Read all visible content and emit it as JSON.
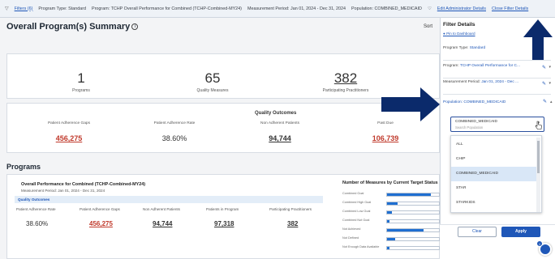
{
  "filterbar": {
    "filters": "Filters (6)",
    "program_type": "Program Type: Standard",
    "program": "Program: TCHP Overall Performance for Combined (TCHP-Combined-MY24)",
    "period": "Measurement Period: Jan 01, 2024 - Dec 31, 2024",
    "population": "Population: COMBINED_MEDICAID",
    "edit_link": "Edit Administrator Details",
    "close_link": "Close Filter Details"
  },
  "summary": {
    "title": "Overall Program(s) Summary",
    "sort_label": "Sort",
    "stats": [
      {
        "value": "1",
        "label": "Programs"
      },
      {
        "value": "65",
        "label": "Quality Measures"
      },
      {
        "value": "382",
        "label": "Participating Practitioners"
      }
    ]
  },
  "quality_outcomes": {
    "title": "Quality Outcomes",
    "cols": [
      {
        "label": "Patient Adherence Gaps",
        "value": "456,275"
      },
      {
        "label": "Patient Adherence Rate",
        "value": "38.60%"
      },
      {
        "label": "Non Adherent Patients",
        "value": "94,744"
      },
      {
        "label": "Past Due",
        "value": "106,739"
      }
    ]
  },
  "programs": {
    "title": "Programs",
    "card_title": "Overall Performance for Combined (TCHP-Combined-MY24)",
    "card_sub": "Measurement Period: Jan 01, 2024 - Dec 31, 2024",
    "band": "Quality Outcomes",
    "cols": [
      {
        "label": "Patient Adherence Rate",
        "value": "38.60%"
      },
      {
        "label": "Patient Adherence Gaps",
        "value": "456,275"
      },
      {
        "label": "Non Adherent Patients",
        "value": "94,744"
      },
      {
        "label": "Patients in Program",
        "value": "97,318"
      },
      {
        "label": "Participating Practitioners",
        "value": "382"
      }
    ],
    "measures_title": "Number of Measures by Current Target Status",
    "measures": [
      {
        "label": "Combined Goal",
        "fill": 0.85
      },
      {
        "label": "Combined High Goal",
        "fill": 0.2
      },
      {
        "label": "Combined Low Goal",
        "fill": 0.1
      },
      {
        "label": "Combined Not Goal",
        "fill": 0.05
      },
      {
        "label": "Not Achieved",
        "fill": 0.7
      },
      {
        "label": "Not Defined",
        "fill": 0.15
      },
      {
        "label": "Not Enough Data Available",
        "fill": 0.05
      }
    ]
  },
  "panel": {
    "title": "Filter Details",
    "pin": "Pin to Dashboard",
    "program_type": "Program Type:",
    "program_type_value": "Standard",
    "program": "Program:",
    "program_value": "TCHP Overall Performance for C...",
    "period": "Measurement Period:",
    "period_value": "Jan 01, 2024 - Dec ...",
    "population": "Population:",
    "population_value": "COMBINED_MEDICAID",
    "dropdown_value": "COMBINED_MEDICAID",
    "dropdown_placeholder": "Search Population",
    "options": [
      "ALL",
      "CHIP",
      "COMBINED_MEDICAID",
      "STAR",
      "STARKIDS"
    ],
    "clear": "Clear",
    "apply": "Apply",
    "help_badge": "1"
  }
}
